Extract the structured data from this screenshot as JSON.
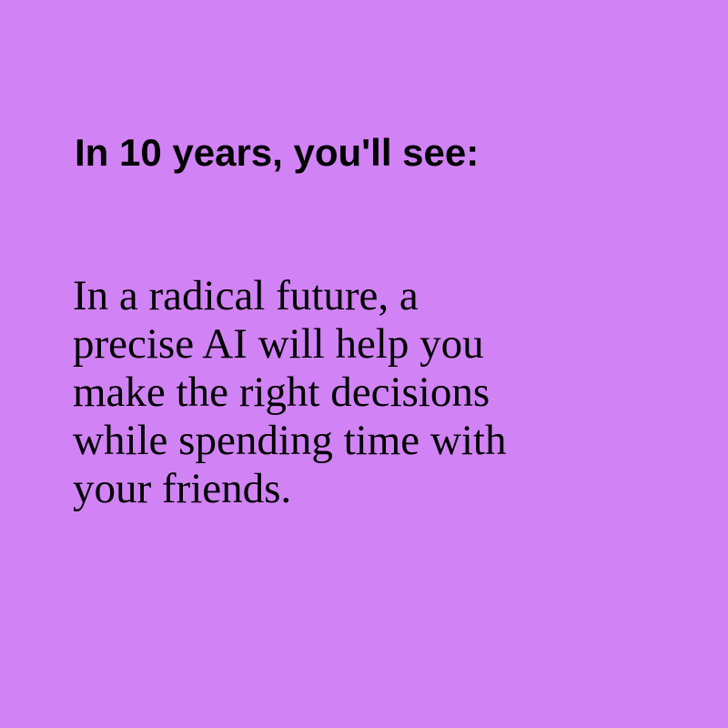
{
  "colors": {
    "background": "#d183f6",
    "text": "#000000"
  },
  "heading": "In 10 years, you'll see:",
  "body_lines": [
    "In a radical future, a",
    "precise AI will help you",
    "make the right decisions",
    "while spending time with",
    "your friends."
  ]
}
